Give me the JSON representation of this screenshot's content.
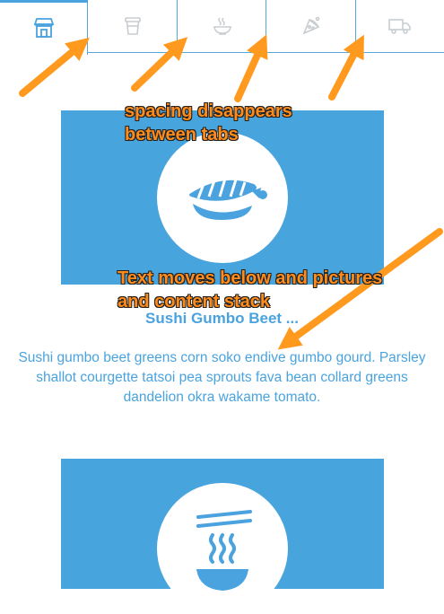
{
  "tabs": [
    {
      "icon": "shop-icon",
      "active": true
    },
    {
      "icon": "cup-icon",
      "active": false
    },
    {
      "icon": "bowl-icon",
      "active": false
    },
    {
      "icon": "pizza-slice-icon",
      "active": false
    },
    {
      "icon": "truck-icon",
      "active": false
    }
  ],
  "cards": [
    {
      "icon": "sushi-icon",
      "title": "Sushi Gumbo Beet ...",
      "description": "Sushi gumbo beet greens corn soko endive gumbo gourd. Parsley shallot courgette tatsoi pea sprouts fava bean collard greens dandelion okra wakame tomato."
    },
    {
      "icon": "noodle-bowl-icon"
    }
  ],
  "annotations": {
    "tabs_note": "spacing disappears between tabs",
    "content_note": "Text moves below and pictures and content stack"
  },
  "colors": {
    "accent": "#4aa3df",
    "panel": "#48a4dc",
    "annotation": "#ff8c1a"
  }
}
